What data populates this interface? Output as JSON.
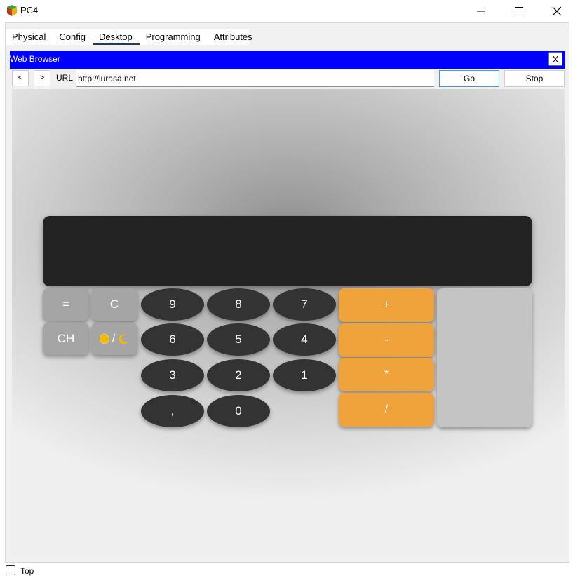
{
  "window": {
    "title": "PC4",
    "icon": "pc-icon",
    "controls": [
      "minimize-icon",
      "maximize-icon",
      "close-icon"
    ]
  },
  "tabs": [
    {
      "label": "Physical",
      "active": false
    },
    {
      "label": "Config",
      "active": false
    },
    {
      "label": "Desktop",
      "active": true
    },
    {
      "label": "Programming",
      "active": false
    },
    {
      "label": "Attributes",
      "active": false
    }
  ],
  "browser": {
    "title": "Web Browser",
    "close_label": "X",
    "back_label": "<",
    "forward_label": ">",
    "url_label": "URL",
    "url_value": "http://lurasa.net",
    "go_label": "Go",
    "stop_label": "Stop",
    "title_color": "#0000ff"
  },
  "calculator": {
    "display_value": "",
    "function_keys": {
      "equals": "=",
      "clear": "C",
      "history": "CH",
      "theme_slash": "/"
    },
    "digits": [
      "9",
      "8",
      "7",
      "6",
      "5",
      "4",
      "3",
      "2",
      "1",
      ",",
      "0"
    ],
    "operators": [
      "+",
      "-",
      "*",
      "/"
    ],
    "colors": {
      "display": "#232323",
      "function": "#a5a5a5",
      "digit": "#333333",
      "operator": "#f0a23b",
      "side_panel": "#c4c4c4"
    }
  },
  "footer": {
    "top_label": "Top",
    "top_checked": false
  }
}
